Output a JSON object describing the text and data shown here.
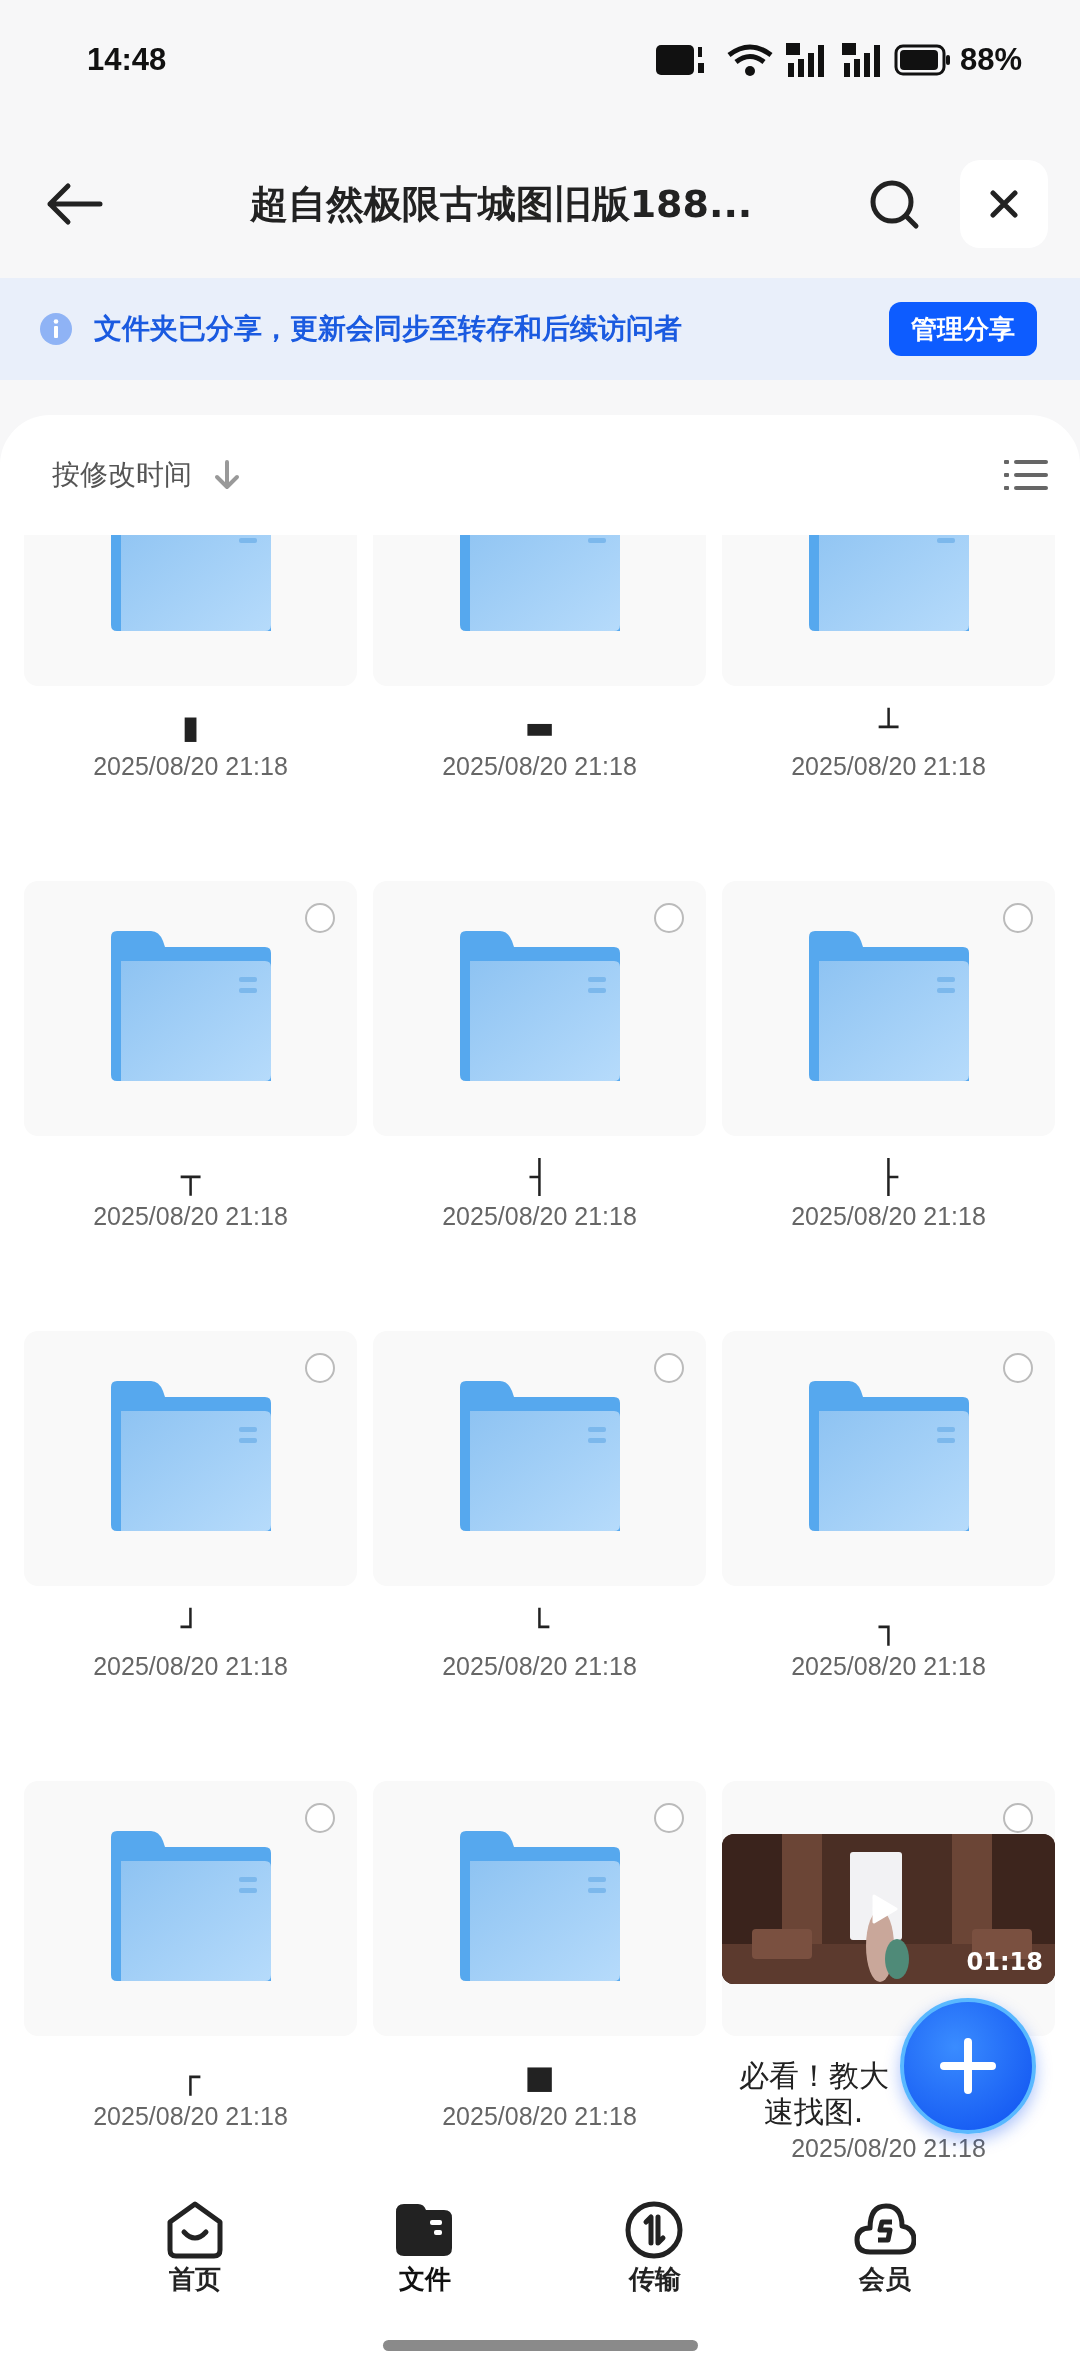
{
  "status_bar": {
    "time": "14:48",
    "battery": "88%"
  },
  "header": {
    "title": "超自然极限古城图旧版188..."
  },
  "banner": {
    "text": "文件夹已分享，更新会同步至转存和后续访问者",
    "button": "管理分享"
  },
  "sort": {
    "label": "按修改时间"
  },
  "items": [
    {
      "kind": "folder",
      "name": "▮",
      "date": "2025/08/20 21:18"
    },
    {
      "kind": "folder",
      "name": "▬",
      "date": "2025/08/20 21:18"
    },
    {
      "kind": "folder",
      "name": "┴",
      "date": "2025/08/20 21:18"
    },
    {
      "kind": "folder",
      "name": "┬",
      "date": "2025/08/20 21:18",
      "checked": false
    },
    {
      "kind": "folder",
      "name": "┤",
      "date": "2025/08/20 21:18",
      "checked": false
    },
    {
      "kind": "folder",
      "name": "├",
      "date": "2025/08/20 21:18",
      "checked": false
    },
    {
      "kind": "folder",
      "name": "┘",
      "date": "2025/08/20 21:18",
      "checked": false
    },
    {
      "kind": "folder",
      "name": "└",
      "date": "2025/08/20 21:18",
      "checked": false
    },
    {
      "kind": "folder",
      "name": "┐",
      "date": "2025/08/20 21:18",
      "checked": false
    },
    {
      "kind": "folder",
      "name": "┌",
      "date": "2025/08/20 21:18",
      "checked": false
    },
    {
      "kind": "folder",
      "name": "■",
      "date": "2025/08/20 21:18",
      "checked": false
    },
    {
      "kind": "video",
      "name_lines": [
        "必看！教大",
        "速找图."
      ],
      "duration": "01:18",
      "date": "2025/08/20 21:18",
      "checked": false
    }
  ],
  "tabs": [
    {
      "label": "首页",
      "selected": false
    },
    {
      "label": "文件",
      "selected": true
    },
    {
      "label": "传输",
      "selected": false
    },
    {
      "label": "会员",
      "selected": false
    }
  ]
}
